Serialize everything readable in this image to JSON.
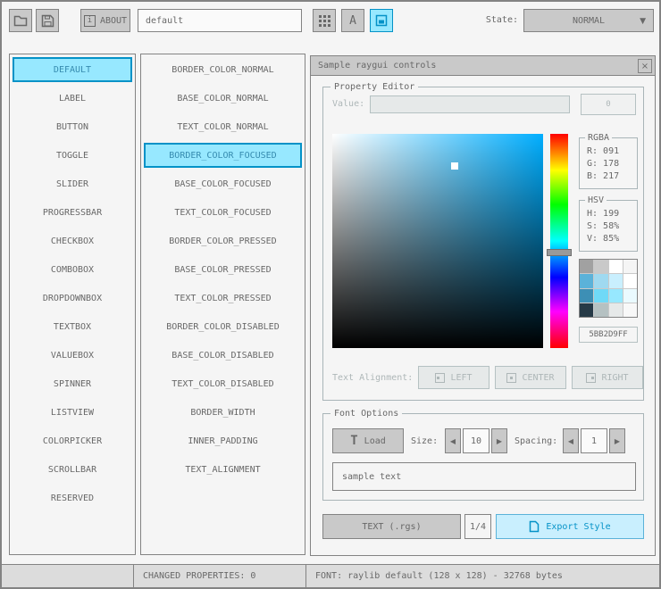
{
  "toolbar": {
    "about_label": "ABOUT",
    "about_icon_letter": "i",
    "style_name": "default",
    "font_button_letter": "A",
    "state_label": "State:",
    "state_value": "NORMAL"
  },
  "controls_list": {
    "selected_index": 0,
    "items": [
      "DEFAULT",
      "LABEL",
      "BUTTON",
      "TOGGLE",
      "SLIDER",
      "PROGRESSBAR",
      "CHECKBOX",
      "COMBOBOX",
      "DROPDOWNBOX",
      "TEXTBOX",
      "VALUEBOX",
      "SPINNER",
      "LISTVIEW",
      "COLORPICKER",
      "SCROLLBAR",
      "RESERVED"
    ]
  },
  "properties_list": {
    "selected_index": 3,
    "items": [
      "BORDER_COLOR_NORMAL",
      "BASE_COLOR_NORMAL",
      "TEXT_COLOR_NORMAL",
      "BORDER_COLOR_FOCUSED",
      "BASE_COLOR_FOCUSED",
      "TEXT_COLOR_FOCUSED",
      "BORDER_COLOR_PRESSED",
      "BASE_COLOR_PRESSED",
      "TEXT_COLOR_PRESSED",
      "BORDER_COLOR_DISABLED",
      "BASE_COLOR_DISABLED",
      "TEXT_COLOR_DISABLED",
      "BORDER_WIDTH",
      "INNER_PADDING",
      "TEXT_ALIGNMENT"
    ]
  },
  "sample_window": {
    "title": "Sample raygui controls",
    "property_editor": {
      "label": "Property Editor",
      "value_label": "Value:",
      "value_text": "",
      "value_button_label": "0",
      "picker": {
        "hue": 199,
        "saturation_pct": 58,
        "value_pct": 85
      },
      "rgba": {
        "label": "RGBA",
        "lines": [
          "R: 091",
          "G: 178",
          "B: 217"
        ]
      },
      "hsv": {
        "label": "HSV",
        "lines": [
          "H: 199",
          "S: 58%",
          "V: 85%"
        ]
      },
      "palette_colors": [
        "#a1a1a1",
        "#c9c9c9",
        "#ffffff",
        "#f5f5f5",
        "#5bb2d9",
        "#9fd9f0",
        "#c9effe",
        "#ffffff",
        "#3d8fb5",
        "#6fd9f7",
        "#97e8ff",
        "#eafaff",
        "#263a47",
        "#b5c1c2",
        "#e6e9e9",
        "#f8f8f8"
      ],
      "hex_value": "5BB2D9FF",
      "text_alignment_label": "Text Alignment:",
      "align_left": "LEFT",
      "align_center": "CENTER",
      "align_right": "RIGHT"
    },
    "font_options": {
      "label": "Font Options",
      "load_icon_letter": "T",
      "load_label": "Load",
      "size_label": "Size:",
      "size_value": "10",
      "spacing_label": "Spacing:",
      "spacing_value": "1",
      "sample_text": "sample text"
    },
    "export_bar": {
      "format_label": "TEXT (.rgs)",
      "page": "1/4",
      "export_label": "Export Style"
    }
  },
  "status_bar": {
    "changed": "CHANGED PROPERTIES: 0",
    "font_info": "FONT: raylib default (128 x 128) - 32768 bytes"
  },
  "icons": {
    "dropdown": "▼",
    "spinner_left": "◀",
    "spinner_right": "▶",
    "close": "×"
  },
  "colors": {
    "accent": "#0492c7",
    "selection_bg": "#97e8ff",
    "selection_text": "#368baf",
    "export_bg": "#c9effe",
    "export_border": "#5bb2d9"
  }
}
